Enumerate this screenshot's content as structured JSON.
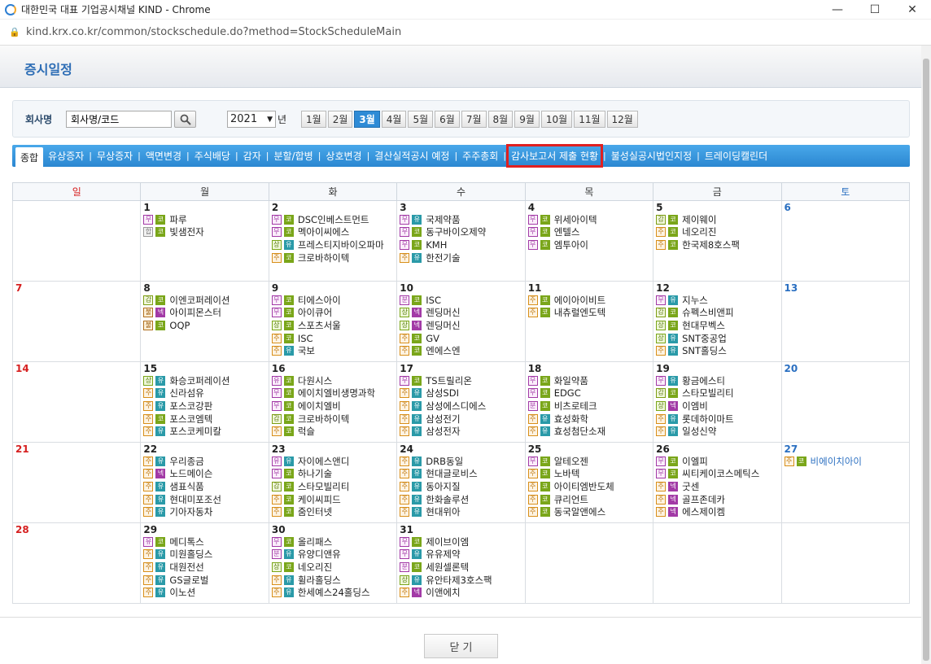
{
  "window": {
    "title": "대한민국 대표 기업공시채널 KIND - Chrome",
    "url": "kind.krx.co.kr/common/stockschedule.do?method=StockScheduleMain"
  },
  "page": {
    "title": "증시일정",
    "close_label": "닫 기"
  },
  "search": {
    "label": "회사명",
    "placeholder": "회사명/코드",
    "year": "2021",
    "year_suffix": "년"
  },
  "months": [
    "1월",
    "2월",
    "3월",
    "4월",
    "5월",
    "6월",
    "7월",
    "8월",
    "9월",
    "10월",
    "11월",
    "12월"
  ],
  "selected_month": "3월",
  "tabs": [
    "종합",
    "유상증자",
    "무상증자",
    "액면변경",
    "주식배당",
    "감자",
    "분할/합병",
    "상호변경",
    "결산실적공시 예정",
    "주주총회",
    "감사보고서 제출 현황",
    "불성실공시법인지정",
    "트레이딩캘린더"
  ],
  "highlighted_tab": "감사보고서 제출 현황",
  "weekdays": [
    "일",
    "월",
    "화",
    "수",
    "목",
    "금",
    "토"
  ],
  "colors": {
    "accent": "#2e8bd6",
    "highlight": "#e02020",
    "sunday": "#d62020",
    "saturday": "#2a6fc1"
  },
  "calendar": [
    [
      {
        "d": "",
        "e": []
      },
      {
        "d": "1",
        "e": [
          [
            "m",
            "무",
            "k",
            "코",
            "파루"
          ],
          [
            "p",
            "합",
            "k",
            "코",
            "빛샘전자"
          ]
        ]
      },
      {
        "d": "2",
        "e": [
          [
            "m",
            "무",
            "k",
            "코",
            "DSC인베스트먼트"
          ],
          [
            "m",
            "무",
            "k",
            "코",
            "멕아이씨에스"
          ],
          [
            "s",
            "상",
            "u",
            "유",
            "프레스티지바이오파마"
          ],
          [
            "j",
            "주",
            "k",
            "코",
            "크로바하이텍"
          ]
        ]
      },
      {
        "d": "3",
        "e": [
          [
            "m",
            "무",
            "u",
            "유",
            "국제약품"
          ],
          [
            "m",
            "무",
            "k",
            "코",
            "동구바이오제약"
          ],
          [
            "m",
            "무",
            "k",
            "코",
            "KMH"
          ],
          [
            "j",
            "주",
            "u",
            "유",
            "한전기술"
          ]
        ]
      },
      {
        "d": "4",
        "e": [
          [
            "m",
            "무",
            "k",
            "코",
            "위세아이텍"
          ],
          [
            "m",
            "무",
            "k",
            "코",
            "엔텔스"
          ],
          [
            "m",
            "무",
            "k",
            "코",
            "엠투아이"
          ]
        ]
      },
      {
        "d": "5",
        "e": [
          [
            "g",
            "감",
            "k",
            "코",
            "제이웨이"
          ],
          [
            "j",
            "주",
            "k",
            "코",
            "네오리진"
          ],
          [
            "j",
            "주",
            "k",
            "코",
            "한국제8호스팩"
          ]
        ]
      },
      {
        "d": "6",
        "e": []
      }
    ],
    [
      {
        "d": "7",
        "e": []
      },
      {
        "d": "8",
        "e": [
          [
            "g",
            "감",
            "k",
            "코",
            "이엔코퍼레이션"
          ],
          [
            "b",
            "불",
            "n",
            "넥",
            "아이피몬스터"
          ],
          [
            "b",
            "불",
            "k",
            "코",
            "OQP"
          ]
        ]
      },
      {
        "d": "9",
        "e": [
          [
            "m",
            "무",
            "k",
            "코",
            "티에스아이"
          ],
          [
            "m",
            "무",
            "k",
            "코",
            "아이큐어"
          ],
          [
            "s",
            "상",
            "k",
            "코",
            "스포츠서울"
          ],
          [
            "j",
            "주",
            "k",
            "코",
            "ISC"
          ],
          [
            "j",
            "주",
            "u",
            "유",
            "국보"
          ]
        ]
      },
      {
        "d": "10",
        "e": [
          [
            "m",
            "분",
            "k",
            "코",
            "ISC"
          ],
          [
            "s",
            "상",
            "n",
            "넥",
            "렌딩머신"
          ],
          [
            "s",
            "상",
            "n",
            "넥",
            "렌딩머신"
          ],
          [
            "j",
            "주",
            "k",
            "코",
            "GV"
          ],
          [
            "j",
            "주",
            "k",
            "코",
            "엔에스엔"
          ]
        ]
      },
      {
        "d": "11",
        "e": [
          [
            "j",
            "주",
            "k",
            "코",
            "에이아이비트"
          ],
          [
            "j",
            "주",
            "k",
            "코",
            "내츄럴엔도텍"
          ]
        ]
      },
      {
        "d": "12",
        "e": [
          [
            "m",
            "무",
            "u",
            "유",
            "지누스"
          ],
          [
            "g",
            "감",
            "k",
            "코",
            "슈펙스비앤피"
          ],
          [
            "s",
            "상",
            "k",
            "코",
            "현대무벡스"
          ],
          [
            "s",
            "상",
            "u",
            "유",
            "SNT중공업"
          ],
          [
            "j",
            "주",
            "u",
            "유",
            "SNT홀딩스"
          ]
        ]
      },
      {
        "d": "13",
        "e": []
      }
    ],
    [
      {
        "d": "14",
        "e": []
      },
      {
        "d": "15",
        "e": [
          [
            "s",
            "상",
            "u",
            "유",
            "화승코퍼레이션"
          ],
          [
            "j",
            "주",
            "u",
            "유",
            "신라섬유"
          ],
          [
            "j",
            "주",
            "u",
            "유",
            "포스코강판"
          ],
          [
            "j",
            "주",
            "k",
            "코",
            "포스코엠텍"
          ],
          [
            "j",
            "주",
            "u",
            "유",
            "포스코케미칼"
          ]
        ]
      },
      {
        "d": "16",
        "e": [
          [
            "y",
            "유",
            "k",
            "코",
            "다원시스"
          ],
          [
            "m",
            "무",
            "k",
            "코",
            "에이치엘비생명과학"
          ],
          [
            "m",
            "무",
            "k",
            "코",
            "에이치엘비"
          ],
          [
            "g",
            "감",
            "k",
            "코",
            "크로바하이텍"
          ],
          [
            "j",
            "주",
            "k",
            "코",
            "럭슬"
          ]
        ]
      },
      {
        "d": "17",
        "e": [
          [
            "m",
            "무",
            "k",
            "코",
            "TS트릴리온"
          ],
          [
            "j",
            "주",
            "u",
            "유",
            "삼성SDI"
          ],
          [
            "j",
            "주",
            "u",
            "유",
            "삼성에스디에스"
          ],
          [
            "j",
            "주",
            "u",
            "유",
            "삼성전기"
          ],
          [
            "j",
            "주",
            "u",
            "유",
            "삼성전자"
          ]
        ]
      },
      {
        "d": "18",
        "e": [
          [
            "m",
            "무",
            "k",
            "코",
            "화일약품"
          ],
          [
            "m",
            "무",
            "k",
            "코",
            "EDGC"
          ],
          [
            "m",
            "분",
            "k",
            "코",
            "비츠로테크"
          ],
          [
            "j",
            "주",
            "u",
            "유",
            "효성화학"
          ],
          [
            "j",
            "주",
            "u",
            "유",
            "효성첨단소재"
          ]
        ]
      },
      {
        "d": "19",
        "e": [
          [
            "m",
            "무",
            "u",
            "유",
            "황금에스티"
          ],
          [
            "g",
            "감",
            "k",
            "코",
            "스타모빌리티"
          ],
          [
            "s",
            "상",
            "n",
            "넥",
            "이엠비"
          ],
          [
            "j",
            "주",
            "u",
            "유",
            "롯데하이마트"
          ],
          [
            "j",
            "주",
            "u",
            "유",
            "일성신약"
          ]
        ]
      },
      {
        "d": "20",
        "e": []
      }
    ],
    [
      {
        "d": "21",
        "e": []
      },
      {
        "d": "22",
        "e": [
          [
            "j",
            "주",
            "u",
            "유",
            "우리종금"
          ],
          [
            "j",
            "주",
            "n",
            "넥",
            "노드메이슨"
          ],
          [
            "j",
            "주",
            "u",
            "유",
            "샘표식품"
          ],
          [
            "j",
            "주",
            "u",
            "유",
            "현대미포조선"
          ],
          [
            "j",
            "주",
            "u",
            "유",
            "기아자동차"
          ]
        ]
      },
      {
        "d": "23",
        "e": [
          [
            "y",
            "유",
            "u",
            "유",
            "자이에스앤디"
          ],
          [
            "m",
            "무",
            "k",
            "코",
            "하나기술"
          ],
          [
            "g",
            "감",
            "k",
            "코",
            "스타모빌리티"
          ],
          [
            "j",
            "주",
            "k",
            "코",
            "케이씨피드"
          ],
          [
            "j",
            "주",
            "k",
            "코",
            "줌인터넷"
          ]
        ]
      },
      {
        "d": "24",
        "e": [
          [
            "j",
            "주",
            "u",
            "유",
            "DRB동일"
          ],
          [
            "j",
            "주",
            "u",
            "유",
            "현대글로비스"
          ],
          [
            "j",
            "주",
            "u",
            "유",
            "동아지질"
          ],
          [
            "j",
            "주",
            "u",
            "유",
            "한화솔루션"
          ],
          [
            "j",
            "주",
            "u",
            "유",
            "현대위아"
          ]
        ]
      },
      {
        "d": "25",
        "e": [
          [
            "m",
            "무",
            "k",
            "코",
            "알테오젠"
          ],
          [
            "j",
            "주",
            "k",
            "코",
            "노바텍"
          ],
          [
            "j",
            "주",
            "k",
            "코",
            "아이티엠반도체"
          ],
          [
            "j",
            "주",
            "k",
            "코",
            "큐리언트"
          ],
          [
            "j",
            "주",
            "k",
            "코",
            "동국알앤에스"
          ]
        ]
      },
      {
        "d": "26",
        "e": [
          [
            "m",
            "무",
            "k",
            "코",
            "이엘피"
          ],
          [
            "m",
            "무",
            "k",
            "코",
            "씨티케이코스메틱스"
          ],
          [
            "j",
            "주",
            "n",
            "넥",
            "굿센"
          ],
          [
            "j",
            "주",
            "n",
            "넥",
            "골프존데카"
          ],
          [
            "j",
            "주",
            "n",
            "넥",
            "에스제이켐"
          ]
        ]
      },
      {
        "d": "27",
        "e": [
          [
            "j",
            "주",
            "k",
            "코",
            "비에이치아이"
          ]
        ]
      }
    ],
    [
      {
        "d": "28",
        "e": []
      },
      {
        "d": "29",
        "e": [
          [
            "y",
            "유",
            "k",
            "코",
            "메디톡스"
          ],
          [
            "j",
            "주",
            "u",
            "유",
            "미원홀딩스"
          ],
          [
            "j",
            "주",
            "u",
            "유",
            "대원전선"
          ],
          [
            "j",
            "주",
            "u",
            "유",
            "GS글로벌"
          ],
          [
            "j",
            "주",
            "u",
            "유",
            "이노션"
          ]
        ]
      },
      {
        "d": "30",
        "e": [
          [
            "m",
            "무",
            "k",
            "코",
            "올리패스"
          ],
          [
            "m",
            "분",
            "u",
            "유",
            "유양디앤유"
          ],
          [
            "s",
            "상",
            "k",
            "코",
            "네오리진"
          ],
          [
            "j",
            "주",
            "u",
            "유",
            "휠라홀딩스"
          ],
          [
            "j",
            "주",
            "u",
            "유",
            "한세예스24홀딩스"
          ]
        ]
      },
      {
        "d": "31",
        "e": [
          [
            "m",
            "무",
            "k",
            "코",
            "제이브이엠"
          ],
          [
            "m",
            "무",
            "u",
            "유",
            "유유제약"
          ],
          [
            "m",
            "분",
            "k",
            "코",
            "세원셀론텍"
          ],
          [
            "s",
            "상",
            "u",
            "유",
            "유안타제3호스팩"
          ],
          [
            "j",
            "주",
            "n",
            "넥",
            "이앤에치"
          ]
        ]
      },
      {
        "d": "",
        "e": []
      },
      {
        "d": "",
        "e": []
      },
      {
        "d": "",
        "e": []
      }
    ]
  ]
}
